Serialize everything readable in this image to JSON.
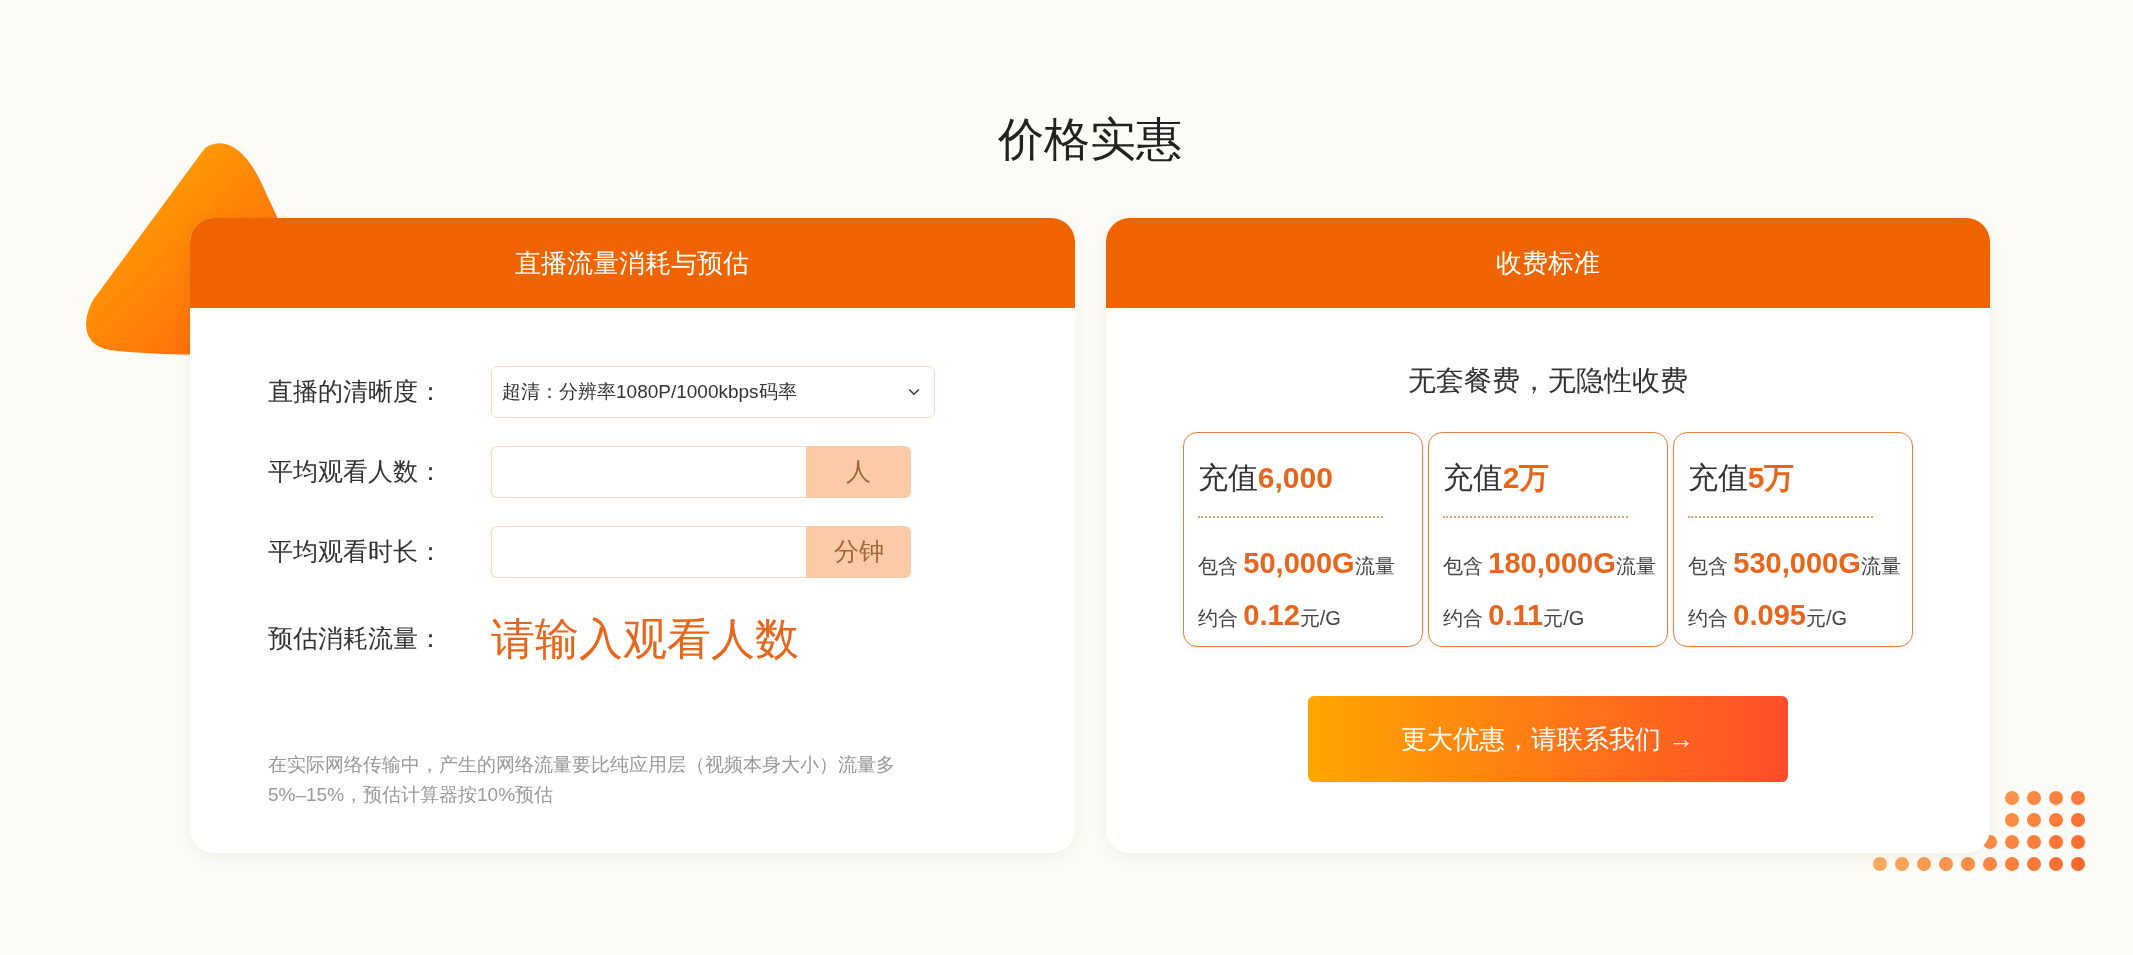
{
  "title": "价格实惠",
  "estimator": {
    "heading": "直播流量消耗与预估",
    "fields": [
      {
        "kind": "select",
        "label": "直播的清晰度：",
        "value": "超清：分辨率1080P/1000kbps码率"
      },
      {
        "kind": "input",
        "label": "平均观看人数：",
        "unit": "人"
      },
      {
        "kind": "input",
        "label": "平均观看时长：",
        "unit": "分钟"
      }
    ],
    "result": {
      "label": "预估消耗流量：",
      "value": "请输入观看人数"
    },
    "note": "在实际网络传输中，产生的网络流量要比纯应用层（视频本身大小）流量多5%–15%，预估计算器按10%预估"
  },
  "pricing": {
    "heading": "收费标准",
    "subtitle": "无套餐费，无隐性收费",
    "plans": [
      {
        "title": "充值**6,000**",
        "traffic": "包含 **50,000G**流量",
        "rate": "约合 **0.12**元/G"
      },
      {
        "title": "充值**2万**",
        "traffic": "包含 **180,000G**流量",
        "rate": "约合 **0.11**元/G"
      },
      {
        "title": "充值**5万**",
        "traffic": "包含 **530,000G**流量",
        "rate": "约合 **0.095**元/G"
      }
    ],
    "contact_button": "更大优惠，请联系我们 →"
  }
}
